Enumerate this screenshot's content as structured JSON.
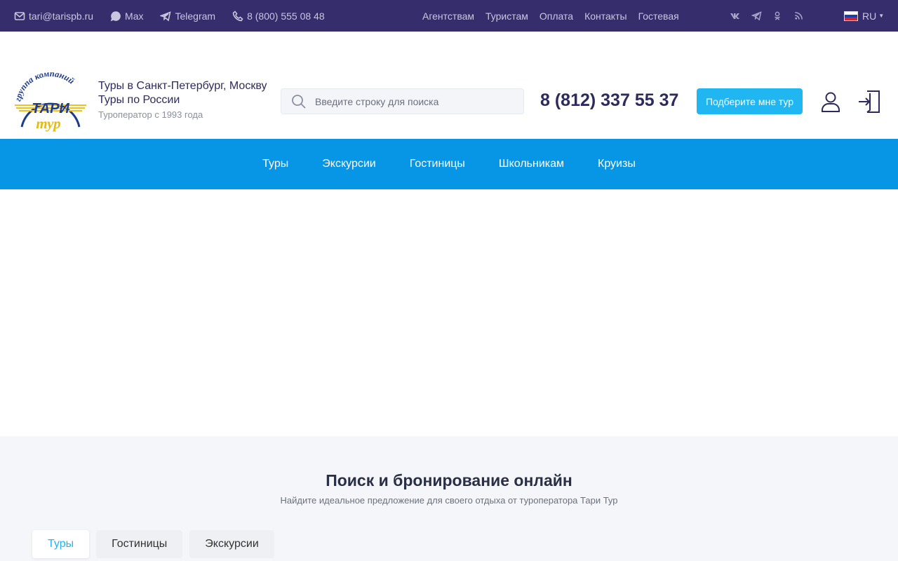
{
  "topbar": {
    "email": "tari@tarispb.ru",
    "max": "Max",
    "telegram": "Telegram",
    "phone": "8 (800) 555 08 48",
    "nav": [
      "Агентствам",
      "Туристам",
      "Оплата",
      "Контакты",
      "Гостевая"
    ],
    "social": [
      "vk-icon",
      "telegram-icon",
      "odnoklassniki-icon",
      "rss-icon"
    ],
    "lang": "RU"
  },
  "header": {
    "logo_text_top": "группа компаний",
    "logo_text_main": "ТАРИ",
    "logo_text_sub": "тур",
    "tagline_1": "Туры в Санкт-Петербург, Москву",
    "tagline_2": "Туры по России",
    "tagline_3": "Туроператор с 1993 года",
    "search_placeholder": "Введите строку для поиска",
    "phone": "8 (812) 337 55 37",
    "cta": "Подберите мне тур"
  },
  "mainnav": [
    "Туры",
    "Экскурсии",
    "Гостиницы",
    "Школьникам",
    "Круизы"
  ],
  "booking": {
    "title": "Поиск и бронирование онлайн",
    "subtitle": "Найдите идеальное предложение для своего отдыха от туроператора Тари Тур",
    "tabs": [
      "Туры",
      "Гостиницы",
      "Экскурсии"
    ],
    "active_tab": "Туры"
  },
  "colors": {
    "topbar": "#352d6c",
    "nav": "#0795e6",
    "accent": "#1fb6f1"
  }
}
